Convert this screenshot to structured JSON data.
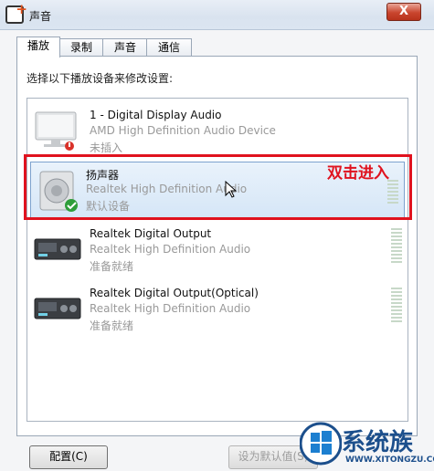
{
  "window": {
    "title": "声音",
    "close_label": "X"
  },
  "tabs": [
    {
      "label": "播放",
      "active": true
    },
    {
      "label": "录制",
      "active": false
    },
    {
      "label": "声音",
      "active": false
    },
    {
      "label": "通信",
      "active": false
    }
  ],
  "prompt": "选择以下播放设备来修改设置:",
  "devices": [
    {
      "name": "1 - Digital Display Audio",
      "driver": "AMD High Definition Audio Device",
      "status": "未插入",
      "icon": "monitor-speaker-icon",
      "selected": false
    },
    {
      "name": "扬声器",
      "driver": "Realtek High Definition Audio",
      "status": "默认设备",
      "icon": "speaker-icon",
      "selected": true
    },
    {
      "name": "Realtek Digital Output",
      "driver": "Realtek High Definition Audio",
      "status": "准备就绪",
      "icon": "digital-output-icon",
      "selected": false
    },
    {
      "name": "Realtek Digital Output(Optical)",
      "driver": "Realtek High Definition Audio",
      "status": "准备就绪",
      "icon": "optical-output-icon",
      "selected": false
    }
  ],
  "annotation": {
    "text": "双击进入",
    "color": "#e0121e"
  },
  "buttons": {
    "configure": "配置(C)",
    "set_default": "设为默认值(S)"
  },
  "watermark": {
    "brand": "系统族",
    "url": "WWW.XITONGZU.COM"
  }
}
